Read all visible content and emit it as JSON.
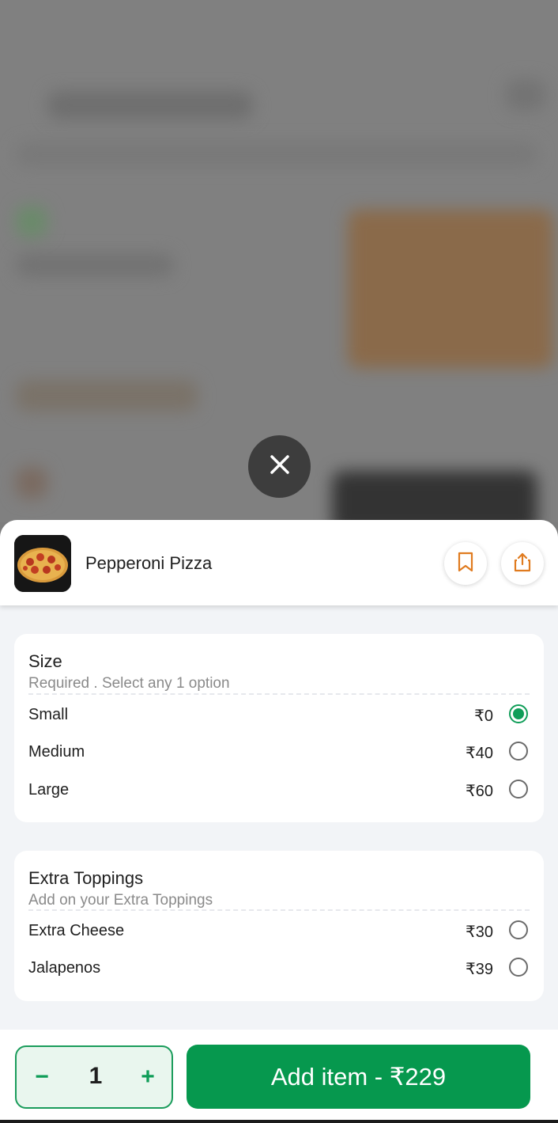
{
  "item": {
    "title": "Pepperoni Pizza"
  },
  "icons": {
    "close": "close-icon",
    "bookmark": "bookmark-icon",
    "share": "share-icon"
  },
  "size_group": {
    "title": "Size",
    "subtitle": "Required . Select any 1 option",
    "options": [
      {
        "label": "Small",
        "price": "₹0",
        "selected": true
      },
      {
        "label": "Medium",
        "price": "₹40",
        "selected": false
      },
      {
        "label": "Large",
        "price": "₹60",
        "selected": false
      }
    ]
  },
  "toppings_group": {
    "title": "Extra Toppings",
    "subtitle": "Add on your Extra Toppings",
    "options": [
      {
        "label": "Extra Cheese",
        "price": "₹30",
        "selected": false
      },
      {
        "label": "Jalapenos",
        "price": "₹39",
        "selected": false
      }
    ]
  },
  "footer": {
    "minus": "−",
    "quantity": "1",
    "plus": "+",
    "add_button": "Add item - ₹229"
  },
  "colors": {
    "accent_green": "#06984e",
    "accent_orange": "#e07b1f"
  }
}
